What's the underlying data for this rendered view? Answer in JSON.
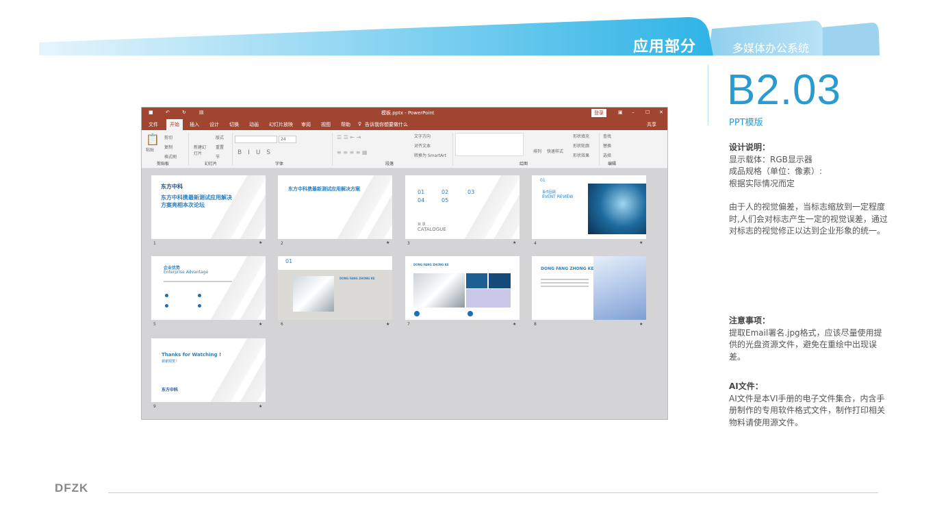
{
  "header": {
    "section": "应用部分",
    "subsection": "多媒体办公系统",
    "accent": "#2fb4e6"
  },
  "page": {
    "code": "B2.03",
    "title": "PPT模版"
  },
  "notes": {
    "design_heading": "设计说明：",
    "design_lines": [
      "显示载体：RGB显示器",
      "成品规格（单位：像素）:",
      "根据实际情况而定"
    ],
    "design_para": "由于人的视觉偏差，当标志缩放到一定程度时,人们会对标志产生一定的视觉误差，通过对标志的视觉修正以达到企业形象的统一。",
    "caution_heading": "注意事项：",
    "caution_para": "提取Email署名.jpg格式，应该尽量使用提供的光盘资源文件，避免在重绘中出现误差。",
    "ai_heading": "AI文件：",
    "ai_para": "AI文件是本VI手册的电子文件集合，内含手册制作的专用软件格式文件，制作打印相关物料请使用源文件。"
  },
  "ppt": {
    "title": "模板.pptx - PowerPoint",
    "login": "登录",
    "tabs": [
      "文件",
      "开始",
      "插入",
      "设计",
      "切换",
      "动画",
      "幻灯片放映",
      "审阅",
      "视图",
      "帮助"
    ],
    "tell_me": "告诉我你想要做什么",
    "share": "共享",
    "font_size": "24",
    "ribbon_items": {
      "paste": "粘贴",
      "cut": "剪切",
      "copy": "复制",
      "format_painter": "格式刷",
      "new_slide": "新建幻灯片",
      "layout": "版式",
      "reset": "重置",
      "section": "节",
      "text_direction": "文字方向",
      "align_text": "对齐文本",
      "smartart": "转换为 SmartArt",
      "arrange": "排列",
      "quick_styles": "快速样式",
      "shape_fill": "形状填充",
      "shape_outline": "形状轮廓",
      "shape_effects": "形状效果",
      "find": "查找",
      "replace": "替换",
      "select": "选择"
    },
    "groups": [
      "剪贴板",
      "幻灯片",
      "字体",
      "段落",
      "绘图",
      "编辑"
    ],
    "slides": [
      {
        "n": "1",
        "title": "东方中科携最新测试应用解决方案亮相本次论坛",
        "logo": "东方中科"
      },
      {
        "n": "2",
        "title": "东方中科携最新测试应用解决方案"
      },
      {
        "n": "3",
        "items": [
          "01",
          "02",
          "03",
          "04",
          "05"
        ],
        "label_cn": "目 录",
        "label_en": "CATALOGUE"
      },
      {
        "n": "4",
        "num": "01",
        "label_cn": "事件回顾",
        "label_en": "EVENT REVIEW"
      },
      {
        "n": "5",
        "label_cn": "企业优势",
        "label_en": "Enterprise Advantage"
      },
      {
        "n": "6",
        "num": "01",
        "heading": "DONG FANG ZHONG KE"
      },
      {
        "n": "7",
        "heading": "DONG FANG ZHONG KE"
      },
      {
        "n": "8",
        "heading": "DONG FANG ZHONG KE"
      },
      {
        "n": "9",
        "title": "Thanks for Watching !",
        "sub": "谢谢观赏！",
        "logo": "东方中科"
      }
    ]
  },
  "footer": {
    "logo": "DFZK"
  }
}
